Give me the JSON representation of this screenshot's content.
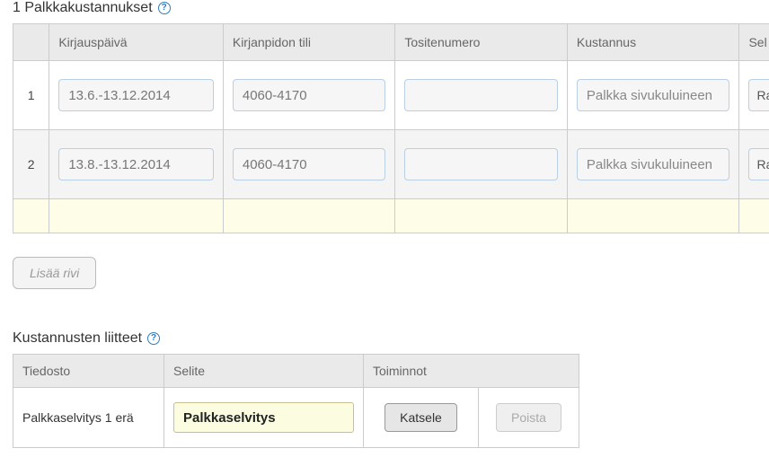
{
  "section1": {
    "title": "1 Palkkakustannukset",
    "headers": {
      "num": "",
      "date": "Kirjauspäivä",
      "account": "Kirjanpidon tili",
      "voucher": "Tositenumero",
      "cost": "Kustannus",
      "sel": "Sel"
    },
    "rows": [
      {
        "num": "1",
        "date": "13.6.-13.12.2014",
        "account": "4060-4170",
        "voucher": "",
        "cost_placeholder": "Palkka sivukuluineen",
        "sel_label": "Ra"
      },
      {
        "num": "2",
        "date": "13.8.-13.12.2014",
        "account": "4060-4170",
        "voucher": "",
        "cost_placeholder": "Palkka sivukuluineen",
        "sel_label": "Ra"
      }
    ],
    "add_row_label": "Lisää rivi"
  },
  "section2": {
    "title": "Kustannusten liitteet",
    "headers": {
      "file": "Tiedosto",
      "desc": "Selite",
      "actions": "Toiminnot"
    },
    "rows": [
      {
        "file": "Palkkaselvitys 1 erä",
        "desc": "Palkkaselvitys",
        "view_label": "Katsele",
        "delete_label": "Poista"
      }
    ]
  }
}
